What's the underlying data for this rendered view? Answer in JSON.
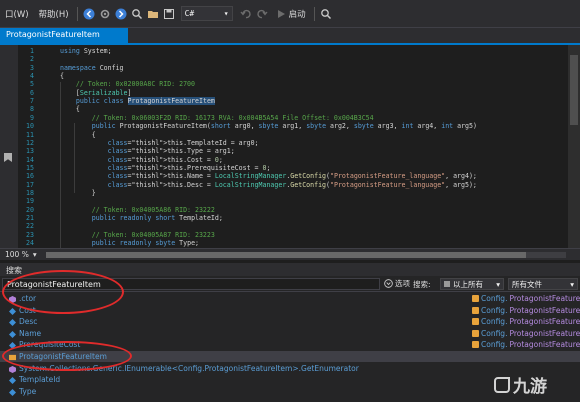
{
  "menubar": {
    "items": [
      "口(W)",
      "帮助(H)"
    ],
    "language": "C#",
    "run_label": "启动"
  },
  "tab": {
    "title": "ProtagonistFeatureItem"
  },
  "code": {
    "lines": [
      {
        "n": "1",
        "text": "using System;"
      },
      {
        "n": "2",
        "text": ""
      },
      {
        "n": "3",
        "text": "namespace Config"
      },
      {
        "n": "4",
        "text": "{"
      },
      {
        "n": "5",
        "text": "    // Token: 0x02000A8C RID: 2700"
      },
      {
        "n": "6",
        "text": "    [Serializable]"
      },
      {
        "n": "7",
        "text": "    public class ProtagonistFeatureItem"
      },
      {
        "n": "8",
        "text": "    {"
      },
      {
        "n": "9",
        "text": "        // Token: 0x06003F2D RID: 16173 RVA: 0x004B5A54 File Offset: 0x004B3C54"
      },
      {
        "n": "10",
        "text": "        public ProtagonistFeatureItem(short arg0, sbyte arg1, sbyte arg2, sbyte arg3, int arg4, int arg5)"
      },
      {
        "n": "11",
        "text": "        {"
      },
      {
        "n": "12",
        "text": "            this.TemplateId = arg0;"
      },
      {
        "n": "13",
        "text": "            this.Type = arg1;"
      },
      {
        "n": "14",
        "text": "            this.Cost = 0;"
      },
      {
        "n": "15",
        "text": "            this.PrerequisiteCost = 0;"
      },
      {
        "n": "16",
        "text": "            this.Name = LocalStringManager.GetConfig(\"ProtagonistFeature_language\", arg4);"
      },
      {
        "n": "17",
        "text": "            this.Desc = LocalStringManager.GetConfig(\"ProtagonistFeature_language\", arg5);"
      },
      {
        "n": "18",
        "text": "        }"
      },
      {
        "n": "19",
        "text": ""
      },
      {
        "n": "20",
        "text": "        // Token: 0x04005A86 RID: 23222"
      },
      {
        "n": "21",
        "text": "        public readonly short TemplateId;"
      },
      {
        "n": "22",
        "text": ""
      },
      {
        "n": "23",
        "text": "        // Token: 0x04005A87 RID: 23223"
      },
      {
        "n": "24",
        "text": "        public readonly sbyte Type;"
      }
    ]
  },
  "status": {
    "zoom": "100 %"
  },
  "search_panel": {
    "title": "搜索",
    "query": "ProtagonistFeatureItem",
    "options_label": "选项",
    "search_label": "搜索:",
    "scope": "以上所有",
    "files": "所有文件",
    "results": [
      {
        "name": ".ctor",
        "location_prefix": "Config.",
        "location_type": "ProtagonistFeatureItem",
        "icon": "method-icon"
      },
      {
        "name": "Cost",
        "location_prefix": "Config.",
        "location_type": "ProtagonistFeatureItem",
        "icon": "field-icon"
      },
      {
        "name": "Desc",
        "location_prefix": "Config.",
        "location_type": "ProtagonistFeatureItem",
        "icon": "field-icon"
      },
      {
        "name": "Name",
        "location_prefix": "Config.",
        "location_type": "ProtagonistFeatureItem",
        "icon": "field-icon"
      },
      {
        "name": "PrerequisiteCost",
        "location_prefix": "Config.",
        "location_type": "ProtagonistFeatureItem",
        "icon": "field-icon"
      },
      {
        "name": "ProtagonistFeatureItem",
        "location_prefix": "",
        "location_type": "",
        "icon": "class-icon"
      },
      {
        "name": "System.Collections.Generic.IEnumerable<Config.ProtagonistFeatureItem>.GetEnumerator",
        "location_prefix": "",
        "location_type": "",
        "icon": "method-icon"
      },
      {
        "name": "TemplateId",
        "location_prefix": "",
        "location_type": "",
        "icon": "field-icon"
      },
      {
        "name": "Type",
        "location_prefix": "",
        "location_type": "",
        "icon": "field-icon"
      }
    ]
  },
  "watermark": {
    "text": "九游"
  },
  "colors": {
    "accent": "#007acc",
    "annotation_red": "#e02b2b"
  }
}
